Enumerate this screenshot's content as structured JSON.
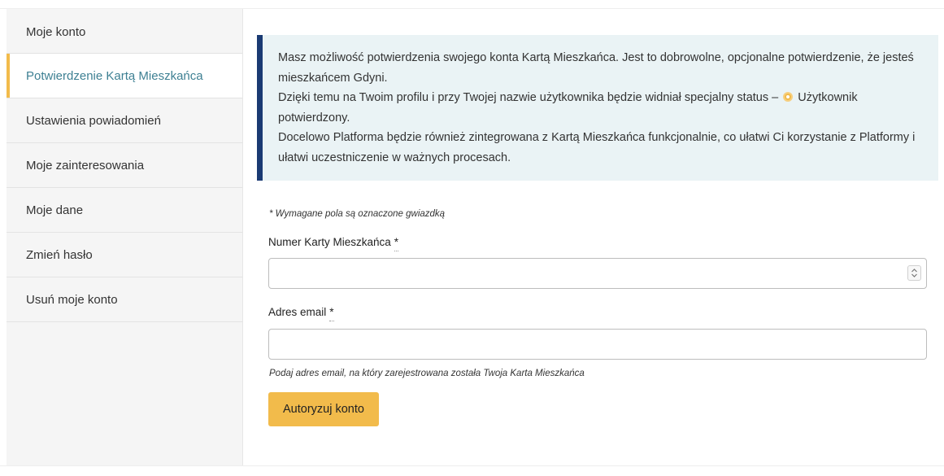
{
  "sidebar": {
    "items": [
      {
        "label": "Moje konto"
      },
      {
        "label": "Potwierdzenie Kartą Mieszkańca",
        "active": true
      },
      {
        "label": "Ustawienia powiadomień"
      },
      {
        "label": "Moje zainteresowania"
      },
      {
        "label": "Moje dane"
      },
      {
        "label": "Zmień hasło"
      },
      {
        "label": "Usuń moje konto"
      }
    ]
  },
  "info": {
    "line1": "Masz możliwość potwierdzenia swojego konta Kartą Mieszkańca. Jest to dobrowolne, opcjonalne potwierdzenie, że jesteś mieszkańcem Gdyni.",
    "line2_before": "Dzięki temu na Twoim profilu i przy Twojej nazwie użytkownika będzie widniał specjalny status –",
    "line2_after": "Użytkownik potwierdzony.",
    "line3": "Docelowo Platforma będzie również zintegrowana z Kartą Mieszkańca funkcjonalnie, co ułatwi Ci korzystanie z Platformy i ułatwi uczestniczenie w ważnych procesach.",
    "badge_icon": "verified-badge-icon",
    "accent_color": "#1a3a73"
  },
  "form": {
    "required_note": "* Wymagane pola są oznaczone gwiazdką",
    "card_label": "Numer Karty Mieszkańca",
    "card_value": "",
    "email_label": "Adres email",
    "email_value": "",
    "required_mark": "*",
    "email_help": "Podaj adres email, na który zarejestrowana została Twoja Karta Mieszkańca",
    "submit_label": "Autoryzuj konto",
    "button_color": "#f2bb4b"
  }
}
